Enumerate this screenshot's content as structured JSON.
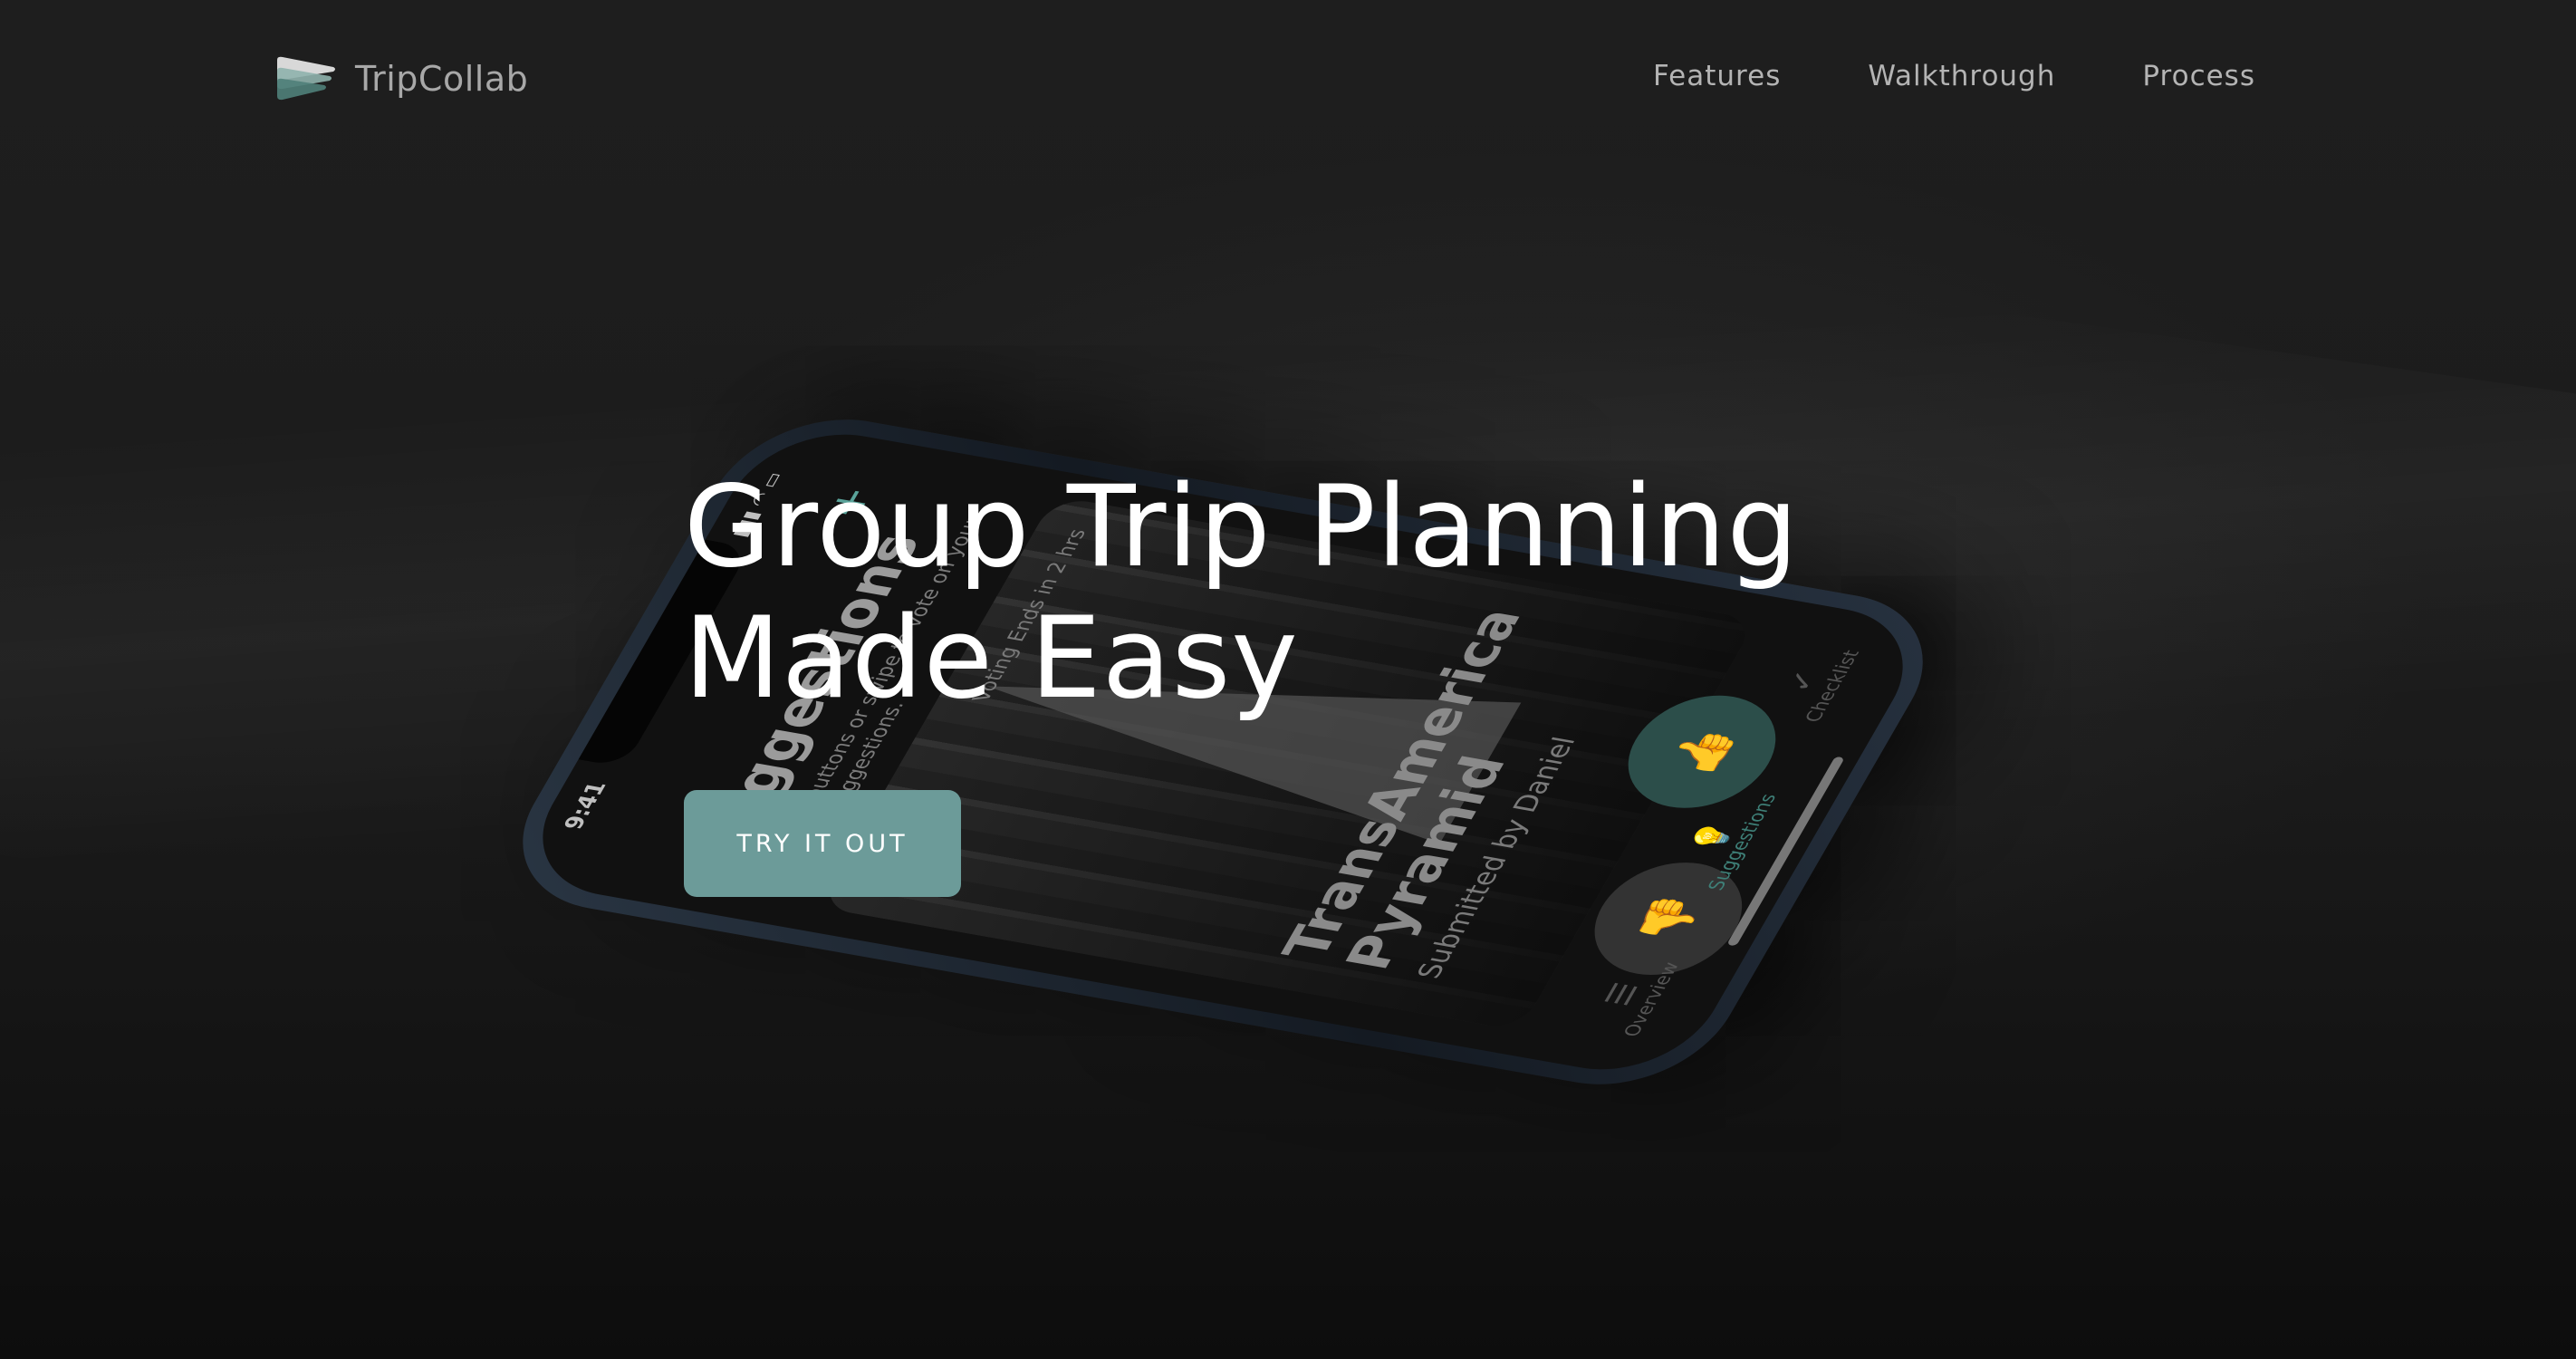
{
  "brand": {
    "name": "TripCollab",
    "logo_icon": "stacked-wedge-logo-icon"
  },
  "nav": {
    "links": [
      {
        "label": "Features"
      },
      {
        "label": "Walkthrough"
      },
      {
        "label": "Process"
      }
    ]
  },
  "hero": {
    "title_line1": "Group Trip Planning",
    "title_line2": "Made Easy",
    "cta_label": "TRY IT OUT"
  },
  "phone": {
    "status_time": "9:41",
    "status_icons": "signal-wifi-battery-icons",
    "screen_title": "Suggestions",
    "screen_subtitle": "Use the buttons or swipe to vote on your friends suggestions.",
    "card": {
      "voting": "Voting Ends in 2 hrs",
      "name": "TransAmerica Pyramid",
      "submitted_by": "Submitted by Daniel"
    },
    "tabs": [
      {
        "label": "Overview",
        "icon": "list-icon"
      },
      {
        "label": "Suggestions",
        "icon": "lightbulb-icon"
      },
      {
        "label": "Checklist",
        "icon": "checkmark-icon"
      }
    ]
  },
  "colors": {
    "accent": "#6c9b99",
    "background": "#1b1b1b",
    "text": "#ffffff",
    "nav_text": "#b4b4b4"
  }
}
